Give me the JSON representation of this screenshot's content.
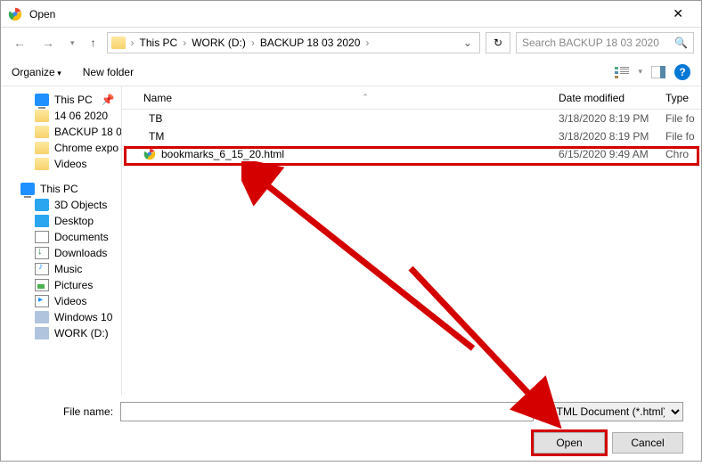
{
  "window": {
    "title": "Open"
  },
  "breadcrumb": {
    "root": "This PC",
    "parts": [
      "WORK (D:)",
      "BACKUP 18 03 2020"
    ]
  },
  "search": {
    "placeholder": "Search BACKUP 18 03 2020"
  },
  "toolbar": {
    "organize": "Organize",
    "newfolder": "New folder"
  },
  "sidebar": {
    "quick": [
      {
        "label": "This PC",
        "icon": "icon-pc",
        "pinned": true
      },
      {
        "label": "14 06 2020",
        "icon": "icon-folder"
      },
      {
        "label": "BACKUP 18 0",
        "icon": "icon-folder"
      },
      {
        "label": "Chrome expo",
        "icon": "icon-folder"
      },
      {
        "label": "Videos",
        "icon": "icon-folder"
      }
    ],
    "pc_label": "This PC",
    "pc": [
      {
        "label": "3D Objects",
        "icon": "icon-3d"
      },
      {
        "label": "Desktop",
        "icon": "icon-desktop"
      },
      {
        "label": "Documents",
        "icon": "icon-doc"
      },
      {
        "label": "Downloads",
        "icon": "icon-download"
      },
      {
        "label": "Music",
        "icon": "icon-music"
      },
      {
        "label": "Pictures",
        "icon": "icon-pic"
      },
      {
        "label": "Videos",
        "icon": "icon-video"
      },
      {
        "label": "Windows 10",
        "icon": "icon-disk"
      },
      {
        "label": "WORK (D:)",
        "icon": "icon-disk"
      }
    ]
  },
  "columns": {
    "name": "Name",
    "date": "Date modified",
    "type": "Type"
  },
  "files": [
    {
      "name": "TB",
      "date": "3/18/2020 8:19 PM",
      "type": "File fo",
      "icon": "folder"
    },
    {
      "name": "TM",
      "date": "3/18/2020 8:19 PM",
      "type": "File fo",
      "icon": "folder"
    },
    {
      "name": "bookmarks_6_15_20.html",
      "date": "6/15/2020 9:49 AM",
      "type": "Chro",
      "icon": "chrome"
    }
  ],
  "bottom": {
    "filename_label": "File name:",
    "filter": "HTML Document (*.html)",
    "open": "Open",
    "cancel": "Cancel"
  }
}
